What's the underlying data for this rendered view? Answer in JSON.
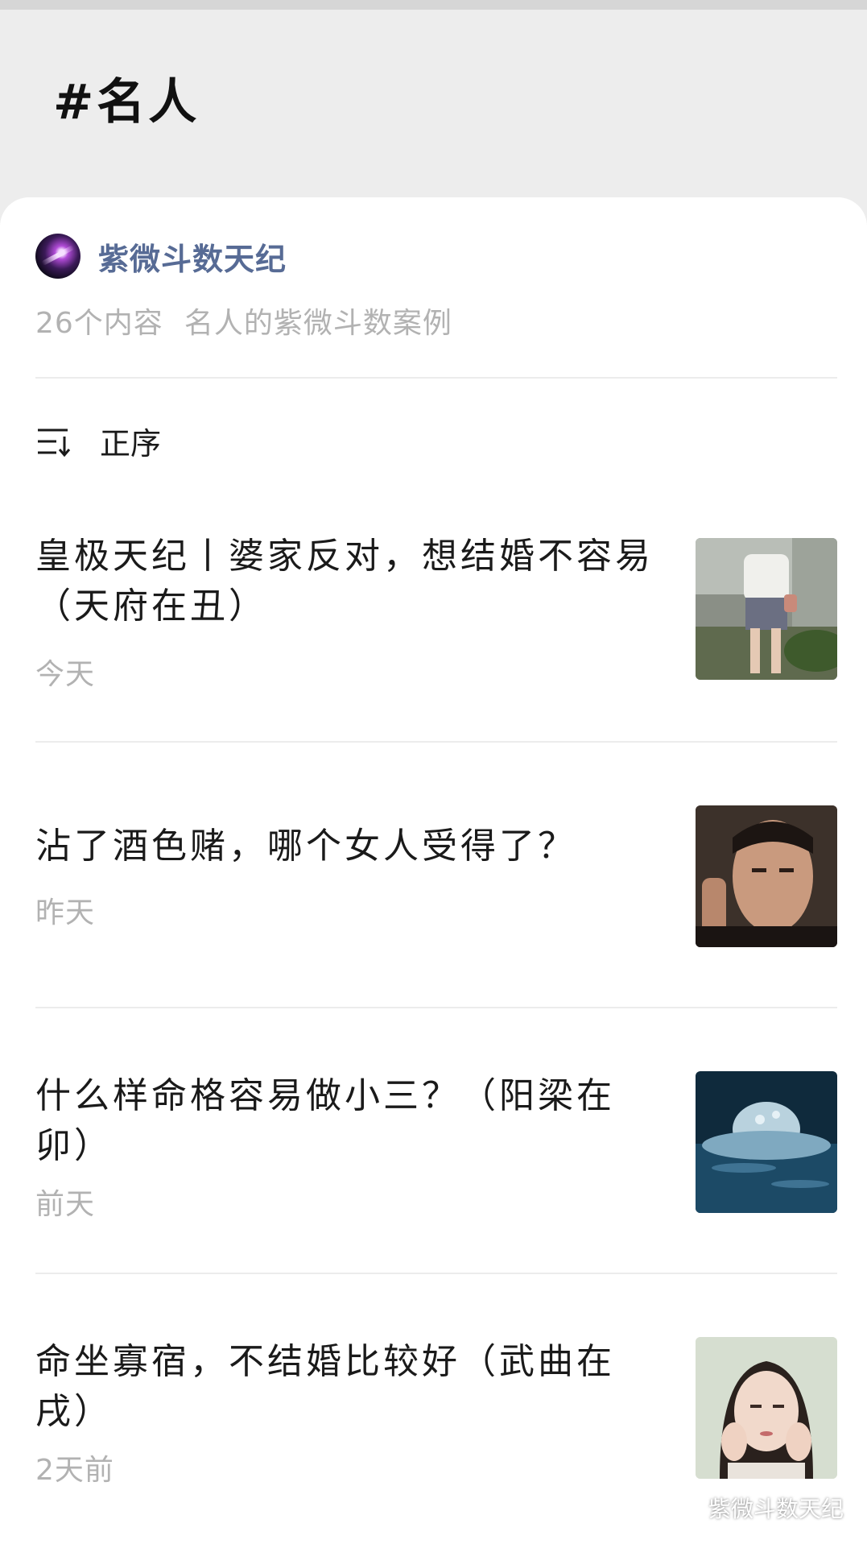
{
  "header": {
    "title": "#名人"
  },
  "account": {
    "name": "紫微斗数天纪"
  },
  "collection": {
    "count": "26个内容",
    "description": "名人的紫微斗数案例"
  },
  "sort": {
    "label": "正序",
    "icon": "sort-icon"
  },
  "articles": [
    {
      "title": "皇极天纪丨婆家反对，想结婚不容易（天府在丑）",
      "date": "今天"
    },
    {
      "title": "沾了酒色赌，哪个女人受得了？",
      "date": "昨天"
    },
    {
      "title": "什么样命格容易做小三？（阳梁在卯）",
      "date": "前天"
    },
    {
      "title": "命坐寡宿，不结婚比较好（武曲在戌）",
      "date": "2天前"
    }
  ],
  "watermark": {
    "text": "紫微斗数天纪",
    "icon": "wechat-icon"
  },
  "colors": {
    "accent": "#576b95",
    "muted": "#b2b2b2",
    "background": "#ededed"
  }
}
